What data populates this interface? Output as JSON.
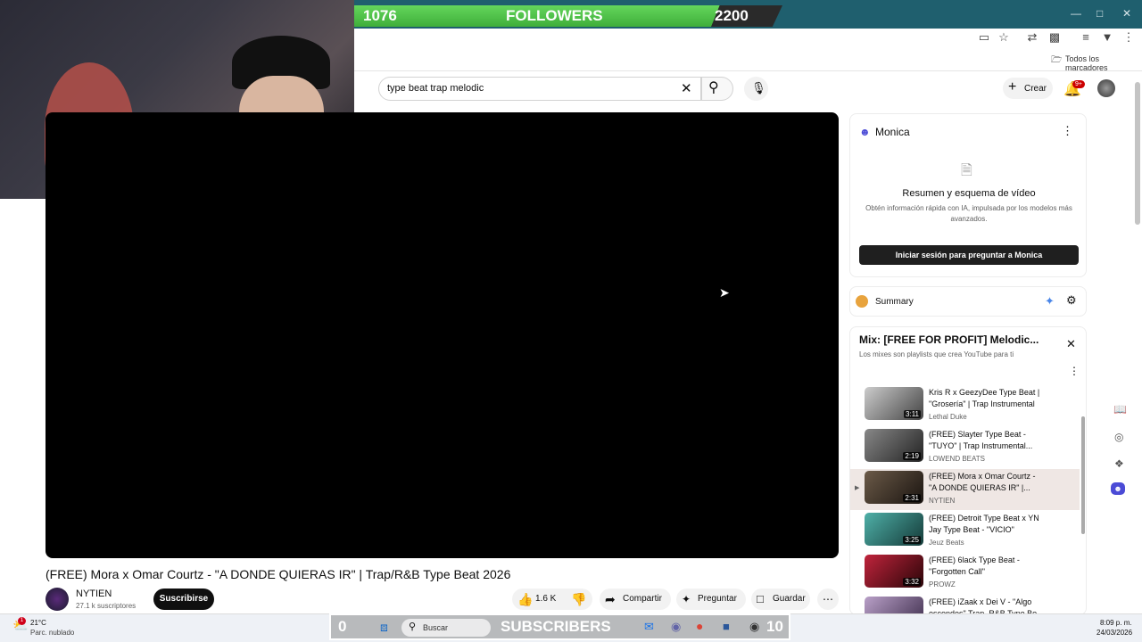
{
  "overlay": {
    "followers_current": "1076",
    "followers_label": "FOLLOWERS",
    "followers_goal": "2200",
    "subscribers_current": "0",
    "subscribers_label": "SUBSCRIBERS",
    "subscribers_goal": "10"
  },
  "browser": {
    "bookmarks_label": "Todos los marcadores"
  },
  "header": {
    "search_value": "type beat trap melodic",
    "create_label": "Crear",
    "notifications_badge": "9+"
  },
  "video": {
    "title": "(FREE) Mora x Omar Courtz - \"A DONDE QUIERAS IR\" | Trap/R&B Type Beat 2026",
    "channel": "NYTIEN",
    "subscribers": "27.1 k suscriptores",
    "subscribe_label": "Suscribirse",
    "likes": "1.6 K",
    "share_label": "Compartir",
    "ask_label": "Preguntar",
    "save_label": "Guardar"
  },
  "monica": {
    "title": "Monica",
    "heading": "Resumen y esquema de vídeo",
    "description": "Obtén información rápida con IA, impulsada por los modelos más avanzados.",
    "login_button": "Iniciar sesión para preguntar a Monica"
  },
  "summary": {
    "label": "Summary"
  },
  "mix": {
    "title": "Mix: [FREE FOR PROFIT] Melodic...",
    "subtitle": "Los mixes son playlists que crea YouTube para ti",
    "items": [
      {
        "title": "Kris R x GeezyDee Type Beat | \"Grosería\" | Trap Instrumental",
        "channel": "Lethal Duke",
        "duration": "3:11"
      },
      {
        "title": "(FREE) Slayter Type Beat - \"TUYO\" | Trap Instrumental...",
        "channel": "LOWEND BEATS",
        "duration": "2:19"
      },
      {
        "title": "(FREE) Mora x Omar Courtz - \"A DONDE QUIERAS IR\" |...",
        "channel": "NYTIEN",
        "duration": "2:31"
      },
      {
        "title": "(FREE) Detroit Type Beat x YN Jay Type Beat - \"VICIO\"",
        "channel": "Jeuz Beats",
        "duration": "3:25"
      },
      {
        "title": "(FREE) 6lack Type Beat - \"Forgotten Call\"",
        "channel": "PROWZ",
        "duration": "3:32"
      },
      {
        "title": "(FREE) iZaak x Dei V - \"Algo escondes\" Trap, R&B Type Be...",
        "channel": "",
        "duration": ""
      }
    ]
  },
  "taskbar": {
    "weather_temp": "21°C",
    "weather_desc": "Parc. nublado",
    "search_placeholder": "Buscar",
    "time": "8:09 p. m.",
    "date": "24/03/2026",
    "weather_badge": "1"
  },
  "colors": {
    "accent": "#065fd4",
    "brand_red": "#ff0000",
    "follower_green": "#4fc24a"
  }
}
